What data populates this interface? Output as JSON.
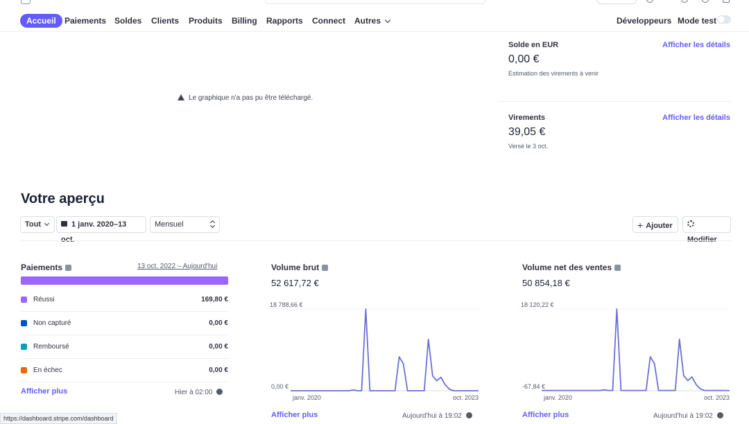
{
  "nav": {
    "items": [
      "Accueil",
      "Paiements",
      "Soldes",
      "Clients",
      "Produits",
      "Billing",
      "Rapports",
      "Connect",
      "Autres"
    ],
    "developers": "Développeurs",
    "test_mode": "Mode test"
  },
  "chart_error": "Le graphique n'a pas pu être téléchargé.",
  "balance": {
    "label": "Solde en EUR",
    "link": "Afficher les détails",
    "amount": "0,00 €",
    "sub": "Estimation des virements à venir"
  },
  "payouts": {
    "label": "Virements",
    "link": "Afficher les détails",
    "amount": "39,05 €",
    "sub": "Versé le 3 oct."
  },
  "overview": {
    "title": "Votre aperçu",
    "filter_all": "Tout",
    "date_range": "1 janv. 2020–13 oct.",
    "interval": "Mensuel",
    "add": "Ajouter",
    "edit": "Modifier"
  },
  "payments": {
    "title": "Paiements",
    "range": "13 oct. 2022 – Aujourd'hui",
    "rows": [
      {
        "label": "Réussi",
        "value": "169,80 €",
        "color": "#9966ff"
      },
      {
        "label": "Non capturé",
        "value": "0,00 €",
        "color": "#0055bc"
      },
      {
        "label": "Remboursé",
        "value": "0,00 €",
        "color": "#00a2b9"
      },
      {
        "label": "En échec",
        "value": "0,00 €",
        "color": "#ed6704"
      }
    ],
    "more": "Afficher plus",
    "updated": "Hier à 02:00"
  },
  "gross": {
    "title": "Volume brut",
    "total": "52 617,72 €",
    "ymax_label": "18 788,66 €",
    "ymin_label": "0,00 €",
    "x_start": "janv. 2020",
    "x_end": "oct. 2023",
    "more": "Afficher plus",
    "updated": "Aujourd'hui à 19:02"
  },
  "net": {
    "title": "Volume net des ventes",
    "total": "50 854,18 €",
    "ymax_label": "18 120,22 €",
    "ymin_label": "-67,84 €",
    "x_start": "janv. 2020",
    "x_end": "oct. 2023",
    "more": "Afficher plus",
    "updated": "Aujourd'hui à 19:02"
  },
  "chart_data": [
    {
      "type": "line",
      "title": "Volume brut",
      "ylim": [
        0,
        18788.66
      ],
      "x_range": [
        "janv. 2020",
        "oct. 2023"
      ],
      "values": [
        0,
        0,
        0,
        0,
        0,
        0,
        0,
        0,
        0,
        0,
        0,
        0,
        0,
        0,
        0,
        200,
        0,
        0,
        18788.66,
        0,
        0,
        0,
        0,
        0,
        0,
        0,
        7800,
        6200,
        0,
        0,
        0,
        0,
        0,
        11800,
        3400,
        2300,
        3100,
        1400,
        400,
        0,
        0,
        0,
        0,
        0,
        0,
        0
      ]
    },
    {
      "type": "line",
      "title": "Volume net des ventes",
      "ylim": [
        -67.84,
        18120.22
      ],
      "x_range": [
        "janv. 2020",
        "oct. 2023"
      ],
      "values": [
        0,
        0,
        0,
        0,
        0,
        0,
        0,
        0,
        0,
        0,
        0,
        0,
        0,
        0,
        0,
        150,
        0,
        0,
        18120.22,
        0,
        0,
        0,
        0,
        0,
        0,
        0,
        7500,
        6000,
        0,
        0,
        0,
        0,
        0,
        11400,
        3300,
        2200,
        3000,
        1300,
        350,
        0,
        0,
        0,
        0,
        0,
        0,
        -67.84
      ]
    }
  ],
  "status_url": "https://dashboard.stripe.com/dashboard"
}
